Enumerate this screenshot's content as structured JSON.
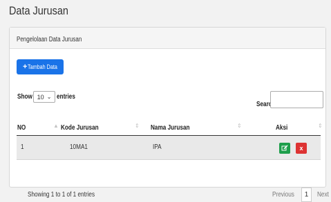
{
  "page": {
    "title": "Data Jurusan"
  },
  "panel": {
    "heading": "Pengelolaan Data Jurusan",
    "add_button": {
      "icon": "plus-icon",
      "label": "Tambah Data"
    }
  },
  "table_controls": {
    "show_label": "Show",
    "length_value": "10",
    "entries_label": "entries",
    "search_label": "Search:",
    "search_value": ""
  },
  "table": {
    "columns": [
      "NO",
      "Kode Jurusan",
      "Nama Jurusan",
      "Aksi"
    ],
    "rows": [
      {
        "no": "1",
        "kode": "10MA1",
        "nama": "IPA"
      }
    ],
    "actions": {
      "edit_icon": "edit-icon",
      "delete_label": "x"
    }
  },
  "footer": {
    "info": "Showing 1 to 1 of 1 entries",
    "previous": "Previous",
    "page": "1",
    "next": "Next"
  },
  "colors": {
    "primary": "#1a73e8",
    "success": "#1e9e4b",
    "danger": "#dd3333"
  }
}
